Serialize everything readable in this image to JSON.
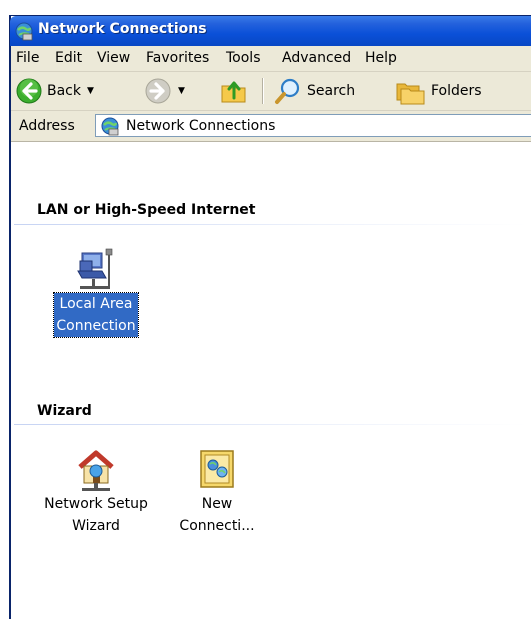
{
  "window": {
    "title": "Network Connections"
  },
  "menu": [
    "File",
    "Edit",
    "View",
    "Favorites",
    "Tools",
    "Advanced",
    "Help"
  ],
  "toolbar": {
    "back": "Back",
    "search": "Search",
    "folders": "Folders"
  },
  "address": {
    "label": "Address",
    "value": "Network Connections"
  },
  "groups": [
    {
      "title": "LAN or High-Speed Internet",
      "items": [
        {
          "label_line1": "Local Area",
          "label_line2": "Connection",
          "icon": "lan-connection-icon",
          "selected": true
        }
      ]
    },
    {
      "title": "Wizard",
      "items": [
        {
          "label_line1": "Network Setup",
          "label_line2": "Wizard",
          "icon": "network-setup-wizard-icon"
        },
        {
          "label_line1": "New",
          "label_line2": "Connecti...",
          "icon": "new-connection-wizard-icon"
        }
      ]
    }
  ],
  "colors": {
    "titlebar": "#0a50d8",
    "chrome": "#ece9d8",
    "selection": "#316ac5"
  }
}
